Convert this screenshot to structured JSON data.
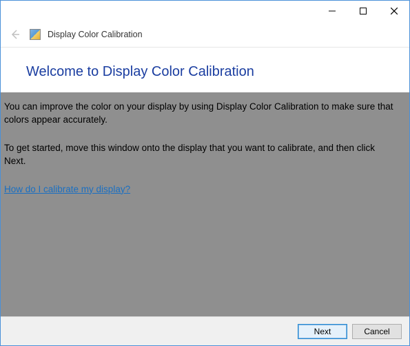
{
  "titlebar": {
    "minimize_icon": "minimize-icon",
    "maximize_icon": "maximize-icon",
    "close_icon": "close-icon"
  },
  "header": {
    "back_icon": "back-arrow-icon",
    "app_title": "Display Color Calibration"
  },
  "main": {
    "heading": "Welcome to Display Color Calibration",
    "paragraph1": "You can improve the color on your display by using Display Color Calibration to make sure that colors appear accurately.",
    "paragraph2": "To get started, move this window onto the display that you want to calibrate, and then click Next.",
    "help_link": "How do I calibrate my display?"
  },
  "footer": {
    "next_label": "Next",
    "cancel_label": "Cancel"
  }
}
